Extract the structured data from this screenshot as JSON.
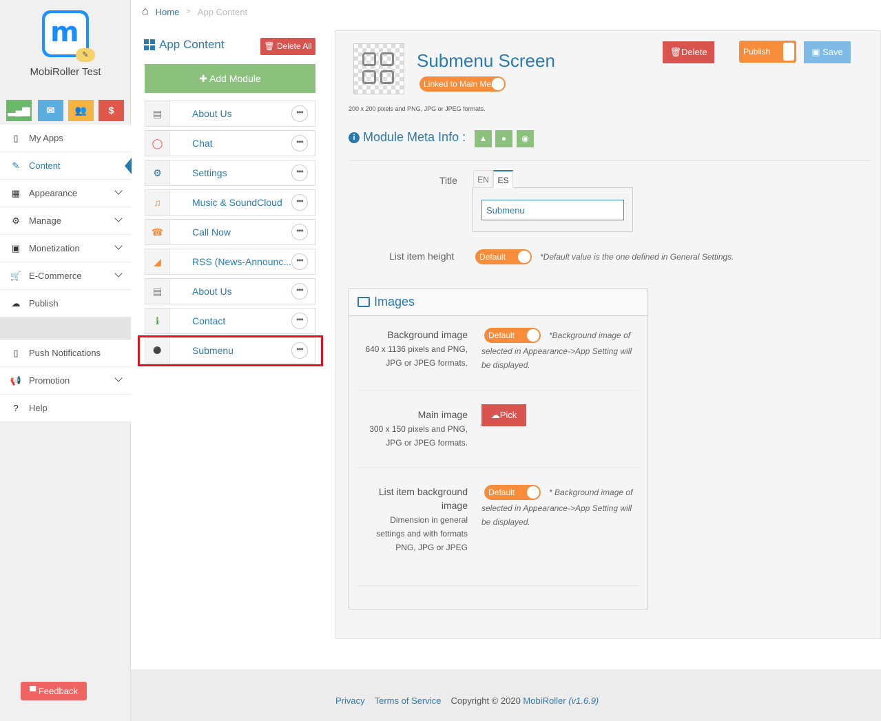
{
  "app": {
    "name": "MobiRoller Test",
    "logo_letter": "m"
  },
  "quick_buttons": [
    {
      "name": "stats",
      "icon": "bar-chart-icon",
      "color": "#6ab86a"
    },
    {
      "name": "mail",
      "icon": "envelope-icon",
      "color": "#5aaee0"
    },
    {
      "name": "users",
      "icon": "users-icon",
      "color": "#f5b442"
    },
    {
      "name": "money",
      "icon": "dollar-icon",
      "color": "#e0584a",
      "glyph": "$"
    }
  ],
  "sidebar": {
    "items": [
      {
        "label": "My Apps",
        "glyph": "▯"
      },
      {
        "label": "Content",
        "glyph": "✎"
      },
      {
        "label": "Appearance",
        "glyph": "▦"
      },
      {
        "label": "Manage",
        "glyph": "⚙"
      },
      {
        "label": "Monetization",
        "glyph": "▣"
      },
      {
        "label": "E-Commerce",
        "glyph": "🛒"
      },
      {
        "label": "Publish",
        "glyph": "☁"
      }
    ],
    "items2": [
      {
        "label": "Push Notifications",
        "glyph": "▯"
      },
      {
        "label": "Promotion",
        "glyph": "📢"
      },
      {
        "label": "Help",
        "glyph": "?"
      }
    ],
    "feedback": "Feedback"
  },
  "breadcrumb": {
    "home": "Home",
    "current": "App Content"
  },
  "content_list": {
    "title": "App Content",
    "delete_all": "Delete All",
    "add_module": "Add Module",
    "modules": [
      {
        "label": "About Us",
        "glyph": "▤",
        "color": "#7a6ad8"
      },
      {
        "label": "Chat",
        "glyph": "◯",
        "color": "#e0584a"
      },
      {
        "label": "Settings",
        "glyph": "⚙",
        "color": "#2a7ab0"
      },
      {
        "label": "Music & SoundCloud",
        "glyph": "♫",
        "color": "#f78c3b"
      },
      {
        "label": "Call Now",
        "glyph": "☎",
        "color": "#f78c3b"
      },
      {
        "label": "RSS (News-Announc...",
        "glyph": "◢",
        "color": "#f78c3b"
      },
      {
        "label": "About Us",
        "glyph": "▤",
        "color": "#7a6ad8"
      },
      {
        "label": "Contact",
        "glyph": "ℹ",
        "color": "#5aa04a"
      },
      {
        "label": "Submenu",
        "glyph": "⚫",
        "color": "#2a7ab0"
      }
    ],
    "more_glyph": "•••"
  },
  "screen": {
    "title": "Submenu Screen",
    "linked_label": "Linked to Main Menu",
    "image_note": "200 x 200 pixels and PNG, JPG or JPEG formats.",
    "delete": "Delete",
    "publish": "Publish",
    "save": "Save",
    "meta_title": "Module Meta Info :",
    "title_label": "Title",
    "lang_tabs": [
      "EN",
      "ES"
    ],
    "title_value": "Submenu",
    "list_height_label": "List item height",
    "default_toggle": "Default",
    "default_note": "*Default value is the one defined in General Settings."
  },
  "images": {
    "header": "Images",
    "background": {
      "label": "Background image",
      "sub1": "640 x 1136 pixels and PNG,",
      "sub2": "JPG or JPEG formats.",
      "note1": "*Background image of",
      "note2": "selected in Appearance->App Setting will",
      "note3": "be displayed."
    },
    "main": {
      "label": "Main image",
      "sub1": "300 x 150 pixels and PNG,",
      "sub2": "JPG or JPEG formats.",
      "pick": "Pick"
    },
    "list_bg": {
      "label1": "List item background",
      "label2": "image",
      "sub1": "Dimension in general",
      "sub2": "settings and with formats",
      "sub3": "PNG, JPG or JPEG",
      "note1": "* Background image of",
      "note2": "selected in Appearance->App Setting will",
      "note3": "be displayed."
    }
  },
  "footer": {
    "privacy": "Privacy",
    "terms": "Terms of Service",
    "copyright": "Copyright © 2020",
    "brand": "MobiRoller",
    "version": "(v1.6.9)"
  }
}
